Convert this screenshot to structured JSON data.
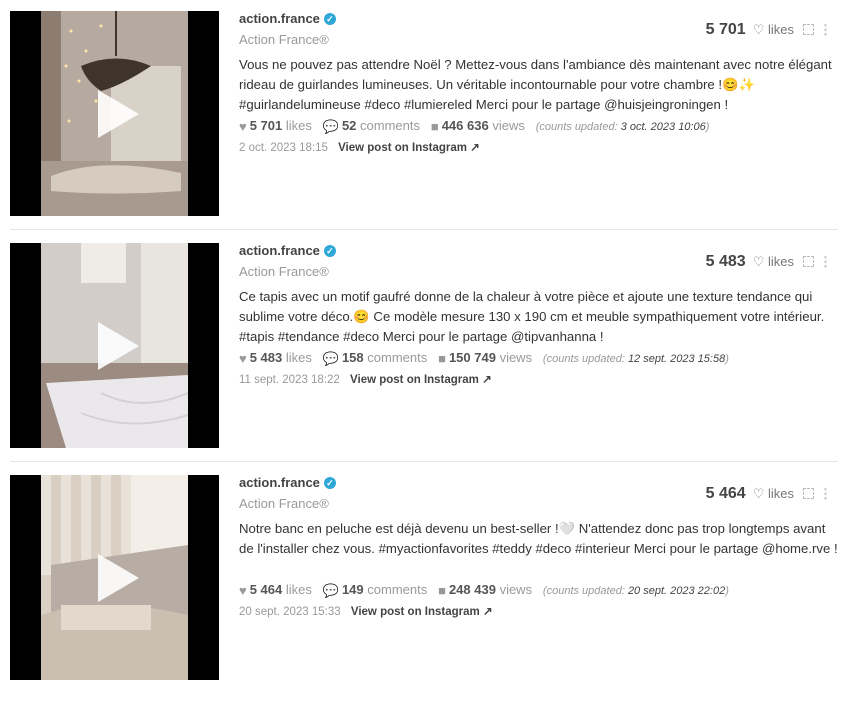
{
  "posts": [
    {
      "username": "action.france",
      "display_name": "Action France®",
      "caption": "Vous ne pouvez pas attendre Noël ? Mettez-vous dans l'ambiance dès maintenant avec notre élégant rideau de guirlandes lumineuses. Un véritable incontournable pour votre chambre !😊✨ #guirlandelumineuse #deco #lumiereled Merci pour le partage @huisjeingroningen !",
      "likes_total": "5 701",
      "likes_label": "likes",
      "likes": "5 701",
      "likes_word": "likes",
      "comments": "52",
      "comments_word": "comments",
      "views": "446 636",
      "views_word": "views",
      "counts_label": "(counts updated:",
      "counts_date": "3 oct. 2023 10:06",
      "counts_close": ")",
      "date": "2 oct. 2023 18:15",
      "link": "View post on Instagram"
    },
    {
      "username": "action.france",
      "display_name": "Action France®",
      "caption": "Ce tapis avec un motif gaufré donne de la chaleur à votre pièce et ajoute une texture tendance qui sublime votre déco.😊 Ce modèle mesure 130 x 190 cm et meuble sympathiquement votre intérieur. #tapis #tendance #deco Merci pour le partage @tipvanhanna !",
      "likes_total": "5 483",
      "likes_label": "likes",
      "likes": "5 483",
      "likes_word": "likes",
      "comments": "158",
      "comments_word": "comments",
      "views": "150 749",
      "views_word": "views",
      "counts_label": "(counts updated:",
      "counts_date": "12 sept. 2023 15:58",
      "counts_close": ")",
      "date": "11 sept. 2023 18:22",
      "link": "View post on Instagram"
    },
    {
      "username": "action.france",
      "display_name": "Action France®",
      "caption": "Notre banc en peluche est déjà devenu un best-seller !🤍 N'attendez donc pas trop longtemps avant de l'installer chez vous. #myactionfavorites #teddy #deco #interieur Merci pour le partage @home.rve !",
      "likes_total": "5 464",
      "likes_label": "likes",
      "likes": "5 464",
      "likes_word": "likes",
      "comments": "149",
      "comments_word": "comments",
      "views": "248 439",
      "views_word": "views",
      "counts_label": "(counts updated:",
      "counts_date": "20 sept. 2023 22:02",
      "counts_close": ")",
      "date": "20 sept. 2023 15:33",
      "link": "View post on Instagram"
    }
  ],
  "colors": {
    "verified": "#2fa8d8",
    "muted": "#999999",
    "text": "#333333"
  }
}
